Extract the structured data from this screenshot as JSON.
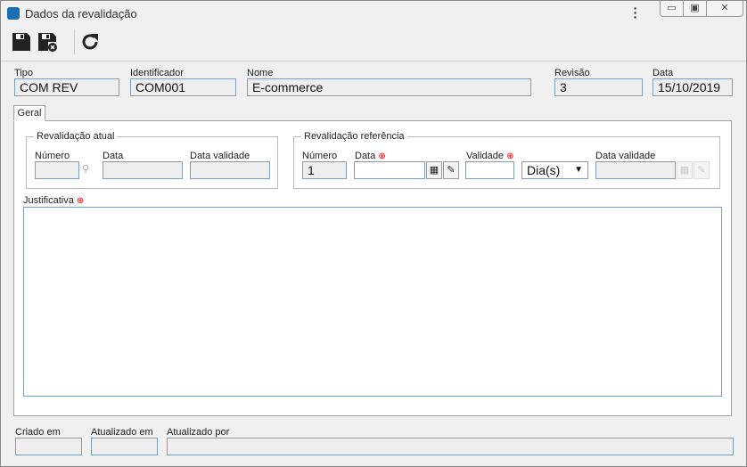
{
  "window": {
    "title": "Dados da revalidação",
    "menu_icon": "kebab-icon",
    "controls": [
      "minimize",
      "maximize",
      "close"
    ]
  },
  "toolbar": {
    "save": "save-icon",
    "save_close": "save-close-icon",
    "refresh": "refresh-icon"
  },
  "header": {
    "tipo": {
      "label": "Tipo",
      "value": "COM REV"
    },
    "identificador": {
      "label": "Identificador",
      "value": "COM001"
    },
    "nome": {
      "label": "Nome",
      "value": "E-commerce"
    },
    "revisao": {
      "label": "Revisão",
      "value": "3"
    },
    "data": {
      "label": "Data",
      "value": "15/10/2019"
    }
  },
  "tabs": [
    {
      "label": "Geral",
      "active": true
    }
  ],
  "atual": {
    "title": "Revalidação atual",
    "numero": "Número",
    "data": "Data",
    "data_validade": "Data validade"
  },
  "referencia": {
    "title": "Revalidação referência",
    "numero": "Número",
    "numero_value": "1",
    "data": "Data",
    "validade": "Validade",
    "unit": "Dia(s)",
    "data_validade": "Data validade"
  },
  "justificativa": {
    "label": "Justificativa",
    "value": ""
  },
  "footer": {
    "criado_em": "Criado em",
    "atualizado_em": "Atualizado em",
    "atualizado_por": "Atualizado por"
  },
  "required_mark": "⊕"
}
